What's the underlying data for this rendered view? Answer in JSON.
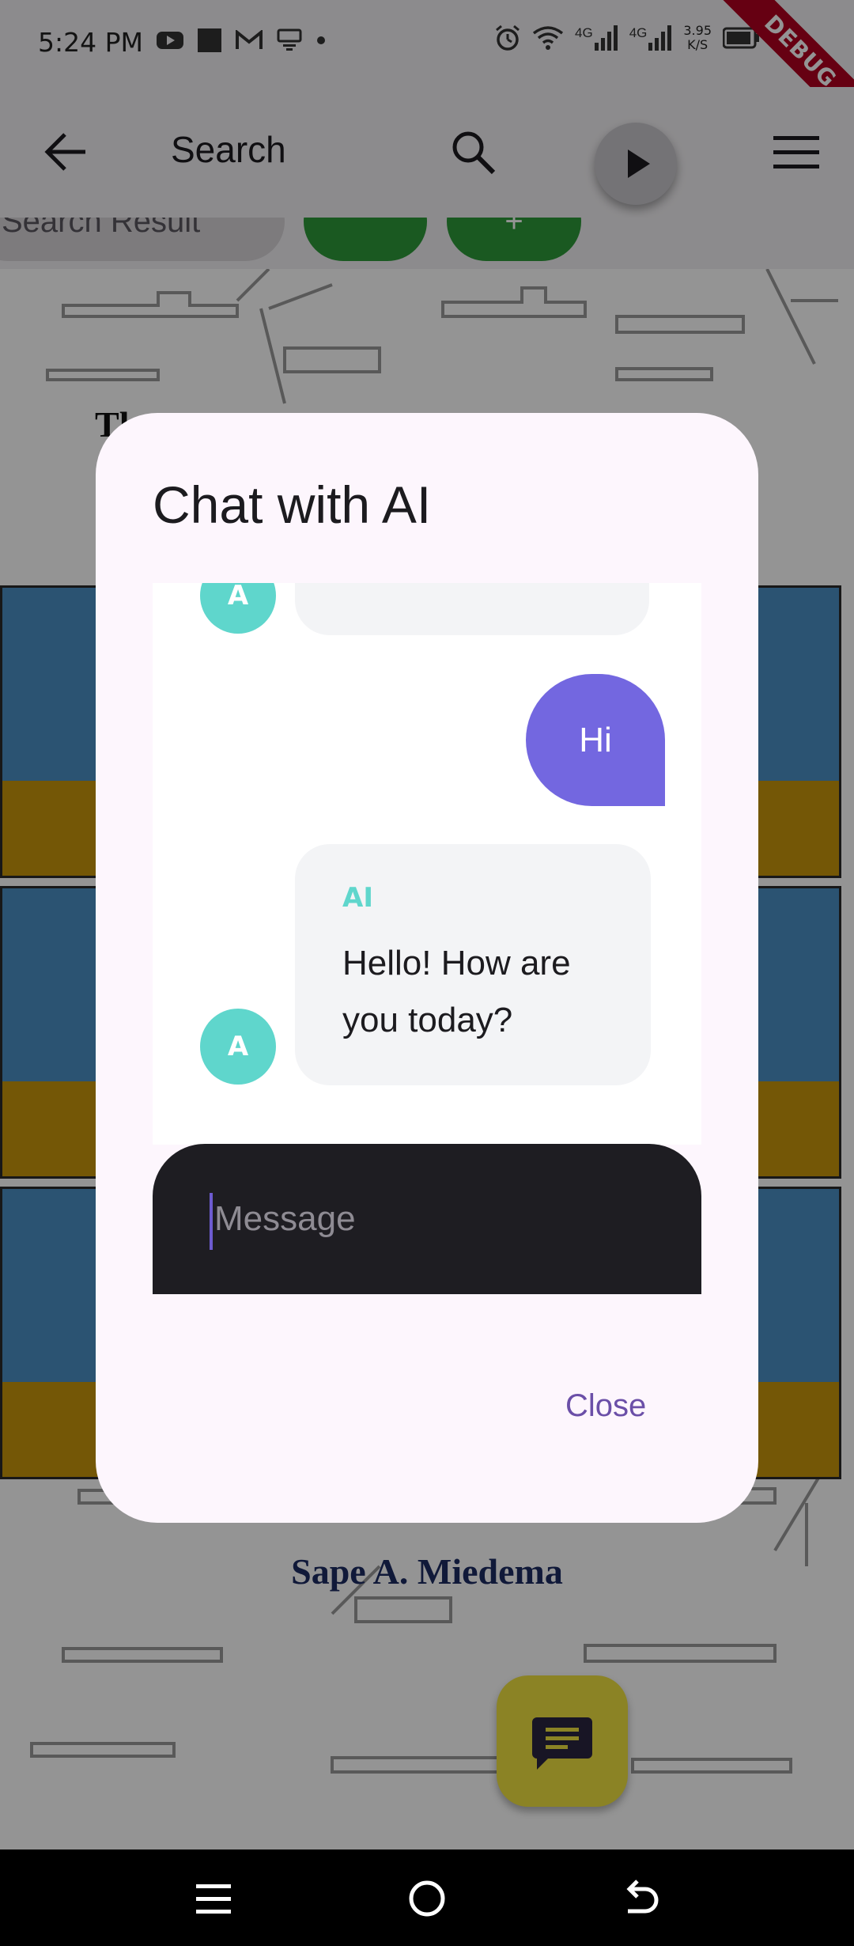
{
  "status_bar": {
    "time": "5:24 PM",
    "network_speed_value": "3.95",
    "network_speed_unit": "K/S",
    "signal_label_1": "4G",
    "signal_label_2": "4G",
    "debug_banner": "DEBUG"
  },
  "app_bar": {
    "title": "Search"
  },
  "chips": {
    "search_result": "Search Result",
    "second_chip_text": "+"
  },
  "cover": {
    "author": "Sape A. Miedema",
    "title_fragment": "Th"
  },
  "dialog": {
    "title": "Chat with AI",
    "messages": [
      {
        "sender": "AI",
        "avatar": "A",
        "text": ""
      },
      {
        "sender": "user",
        "text": "Hi"
      },
      {
        "sender": "AI",
        "avatar": "A",
        "name": "AI",
        "text": "Hello! How are you today?"
      }
    ],
    "input_placeholder": "Message",
    "close_label": "Close"
  },
  "colors": {
    "user_bubble": "#7367e0",
    "ai_avatar": "#5fd6cc",
    "fab": "#f0e241",
    "chip_green": "#2e9a3a"
  }
}
